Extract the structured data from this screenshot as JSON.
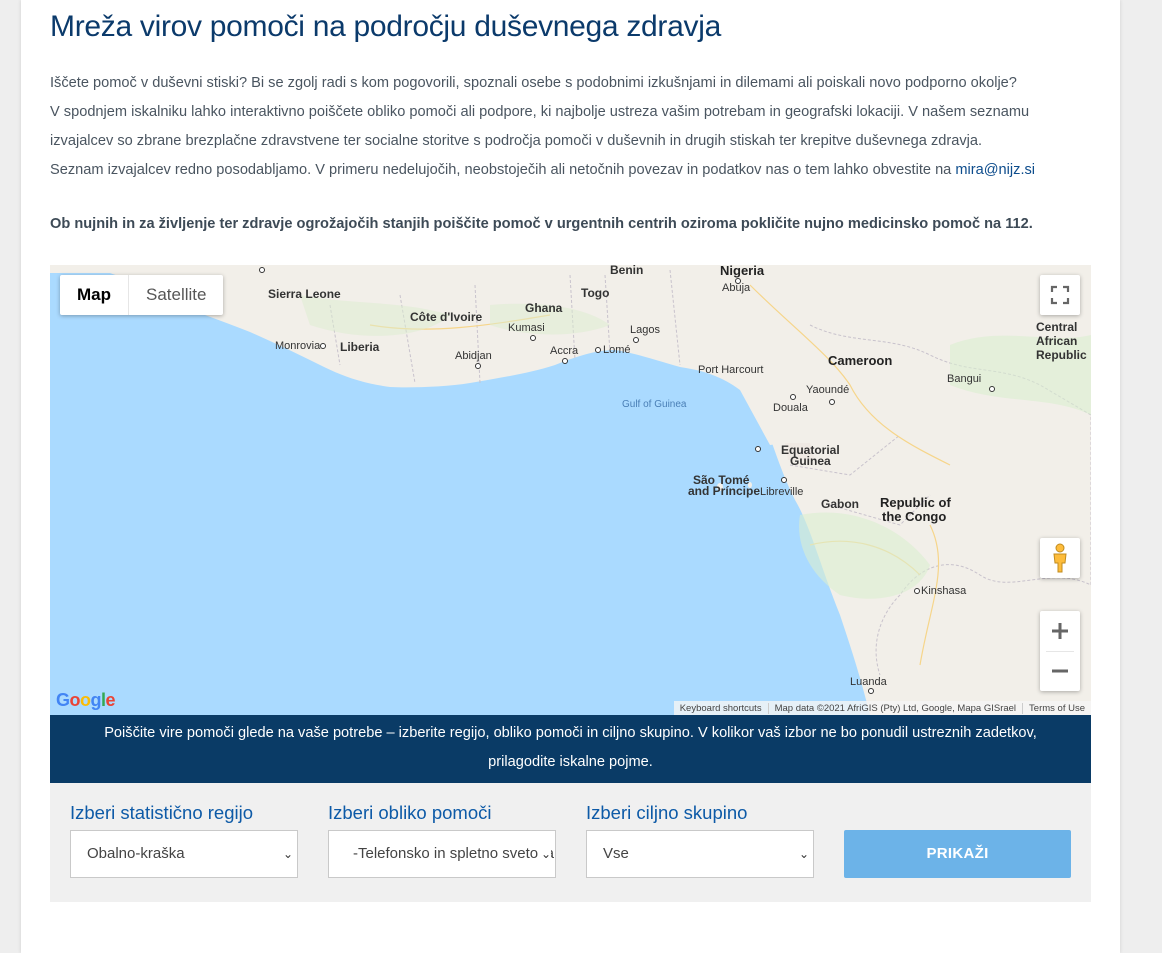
{
  "page": {
    "title": "Mreža virov pomoči na področju duševnega zdravja",
    "intro": [
      "Iščete pomoč v duševni stiski? Bi se zgolj radi s kom pogovorili, spoznali osebe s podobnimi izkušnjami in dilemami ali poiskali novo podporno okolje?",
      "V spodnjem iskalniku lahko interaktivno poiščete obliko pomoči ali podpore, ki najbolje ustreza vašim potrebam in geografski lokaciji. V našem seznamu izvajalcev so zbrane brezplačne zdravstvene ter socialne storitve s področja pomoči v duševnih in drugih stiskah ter krepitve duševnega zdravja.",
      "Seznam izvajalcev redno posodabljamo. V primeru nedelujočih, neobstoječih ali netočnih povezav in podatkov nas o tem lahko obvestite na "
    ],
    "email": "mira@nijz.si",
    "urgent": "Ob nujnih in za življenje ter zdravje ogrožajočih stanjih poiščite pomoč v urgentnih centrih oziroma pokličite nujno medicinsko pomoč na 112."
  },
  "map": {
    "type_map": "Map",
    "type_satellite": "Satellite",
    "google_logo": "Google",
    "keyboard_shortcuts": "Keyboard shortcuts",
    "map_data": "Map data ©2021 AfriGIS (Pty) Ltd, Google, Mapa GISrael",
    "terms": "Terms of Use",
    "icons": [
      "fullscreen-icon",
      "pegman-icon",
      "zoom-in-icon",
      "zoom-out-icon"
    ],
    "labels": {
      "sierra_leone": "Sierra Leone",
      "monrovia": "Monrovia",
      "liberia": "Liberia",
      "cote_divoire": "Côte d'Ivoire",
      "ghana": "Ghana",
      "kumasi": "Kumasi",
      "abidjan": "Abidjan",
      "accra": "Accra",
      "lome": "Lomé",
      "togo": "Togo",
      "benin": "Benin",
      "lagos": "Lagos",
      "nigeria": "Nigeria",
      "abuja": "Abuja",
      "port_harcourt": "Port Harcourt",
      "gulf_of_guinea": "Gulf of Guinea",
      "cameroon": "Cameroon",
      "yaounde": "Yaoundé",
      "douala": "Douala",
      "car_1": "Central",
      "car_2": "African",
      "car_3": "Republic",
      "bangui": "Bangui",
      "eq_guinea_1": "Equatorial",
      "eq_guinea_2": "Guinea",
      "sao_tome_1": "São Tomé",
      "sao_tome_2": "and Príncipe",
      "libreville": "Libreville",
      "gabon": "Gabon",
      "congo_1": "Republic of",
      "congo_2": "the Congo",
      "kinshasa": "Kinshasa",
      "luanda": "Luanda"
    }
  },
  "banner": "Poiščite vire pomoči glede na vaše potrebe – izberite regijo, obliko pomoči in ciljno skupino. V kolikor vaš izbor ne bo ponudil ustreznih zadetkov, prilagodite iskalne pojme.",
  "filters": {
    "region": {
      "label": "Izberi statistično regijo",
      "value": "Obalno-kraška"
    },
    "help_form": {
      "label": "Izberi obliko pomoči",
      "value": "-Telefonsko in spletno svetovanje"
    },
    "target_group": {
      "label": "Izberi ciljno skupino",
      "value": "Vse"
    },
    "submit_label": "PRIKAŽI"
  },
  "colors": {
    "title": "#0b3a6b",
    "banner_bg": "#0a3b66",
    "filter_label": "#0d5aa7",
    "button_bg": "#6cb3e8",
    "water": "#aadaff",
    "land": "#f2efe9"
  }
}
